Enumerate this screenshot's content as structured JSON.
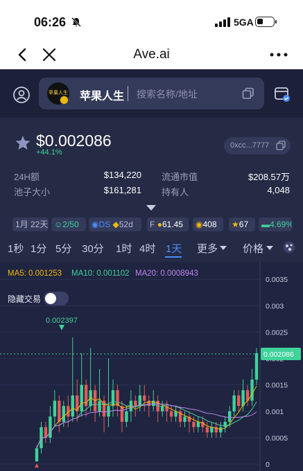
{
  "status_bar": {
    "time": "06:26",
    "network": "5GA"
  },
  "browser": {
    "title": "Ave.ai"
  },
  "search": {
    "token_name": "苹果人生",
    "token_logo_text": "苹果人生",
    "placeholder": "搜索名称/地址"
  },
  "token": {
    "price": "$0.002086",
    "change": "+44.1%",
    "address": "0xcc...7777"
  },
  "stats": {
    "vol_label": "24H额",
    "vol_value": "$134,220",
    "mcap_label": "流通市值",
    "mcap_value": "$208.57万",
    "pool_label": "池子大小",
    "pool_value": "$161,281",
    "holders_label": "持有人",
    "holders_value": "4,048"
  },
  "tags": {
    "age": "1月 22天",
    "ratio": "2/50",
    "ds": "DS",
    "days": "52d",
    "score": "61.45",
    "bag": "408",
    "cup": "67",
    "cash": "4.69%"
  },
  "timeframes": [
    "1秒",
    "1分",
    "5分",
    "30分",
    "1时",
    "4时",
    "1天",
    "更多",
    "价格"
  ],
  "colors": {
    "up": "#3fd29a",
    "down": "#e05b5b",
    "accent": "#4a8dff",
    "bg": "#252a45"
  },
  "chart_data": {
    "type": "candlestick",
    "legend": [
      {
        "name": "MA5",
        "value": "0.001253",
        "color": "#f0b90b"
      },
      {
        "name": "MA10",
        "value": "0.001102",
        "color": "#3fd29a"
      },
      {
        "name": "MA20",
        "value": "0.0008943",
        "color": "#c084f0"
      }
    ],
    "hide_trades_label": "隐藏交易",
    "peak_label": "0.002397",
    "current_price": "0.002086",
    "y_ticks": [
      "0.0035",
      "0.003",
      "0.0025",
      "0.002",
      "0.0015",
      "0.001",
      "0.0005",
      "0"
    ],
    "ylim": [
      0,
      0.0037
    ],
    "candles": [
      [
        5e-05,
        0.0003,
        5e-05,
        0.00035,
        "u"
      ],
      [
        0.0003,
        0.0007,
        0.0002,
        0.0008,
        "u"
      ],
      [
        0.0007,
        0.0005,
        0.0004,
        0.0008,
        "d"
      ],
      [
        0.0005,
        0.0009,
        0.0004,
        0.0011,
        "u"
      ],
      [
        0.0009,
        0.0012,
        0.0007,
        0.0014,
        "u"
      ],
      [
        0.0012,
        0.0008,
        0.0006,
        0.0013,
        "d"
      ],
      [
        0.0008,
        0.0011,
        0.0007,
        0.0012,
        "u"
      ],
      [
        0.0011,
        0.0009,
        0.0007,
        0.0013,
        "d"
      ],
      [
        0.0009,
        0.0013,
        0.0008,
        0.0024,
        "u"
      ],
      [
        0.0013,
        0.001,
        0.0008,
        0.0016,
        "d"
      ],
      [
        0.001,
        0.0015,
        0.0009,
        0.0021,
        "u"
      ],
      [
        0.0015,
        0.0011,
        0.0009,
        0.0016,
        "d"
      ],
      [
        0.0011,
        0.0014,
        0.001,
        0.0022,
        "u"
      ],
      [
        0.0014,
        0.001,
        0.0008,
        0.0015,
        "d"
      ],
      [
        0.001,
        0.0012,
        0.0009,
        0.0018,
        "u"
      ],
      [
        0.0012,
        0.0009,
        0.0006,
        0.0013,
        "d"
      ],
      [
        0.0009,
        0.0011,
        0.0007,
        0.002,
        "u"
      ],
      [
        0.0011,
        0.0014,
        0.0009,
        0.0016,
        "u"
      ],
      [
        0.0014,
        0.0011,
        0.0009,
        0.0015,
        "d"
      ],
      [
        0.0011,
        0.0008,
        0.0006,
        0.0012,
        "d"
      ],
      [
        0.0008,
        0.001,
        0.0007,
        0.0011,
        "u"
      ],
      [
        0.001,
        0.0012,
        0.0008,
        0.0014,
        "u"
      ],
      [
        0.0012,
        0.0011,
        0.0009,
        0.0013,
        "d"
      ],
      [
        0.0011,
        0.0013,
        0.001,
        0.0015,
        "u"
      ],
      [
        0.0013,
        0.0012,
        0.001,
        0.0015,
        "d"
      ],
      [
        0.0012,
        0.0011,
        0.0009,
        0.0013,
        "d"
      ],
      [
        0.0011,
        0.0012,
        0.001,
        0.0014,
        "u"
      ],
      [
        0.0012,
        0.001,
        0.0008,
        0.0013,
        "d"
      ],
      [
        0.001,
        0.0011,
        0.0009,
        0.0012,
        "u"
      ],
      [
        0.0011,
        0.001,
        0.0008,
        0.0012,
        "d"
      ],
      [
        0.001,
        0.0009,
        0.0008,
        0.0011,
        "d"
      ],
      [
        0.0009,
        0.001,
        0.0008,
        0.0011,
        "u"
      ],
      [
        0.001,
        0.0008,
        0.0007,
        0.0011,
        "d"
      ],
      [
        0.0008,
        0.0009,
        0.0007,
        0.001,
        "u"
      ],
      [
        0.0009,
        0.0008,
        0.0006,
        0.001,
        "d"
      ],
      [
        0.0008,
        0.0007,
        0.0006,
        0.0009,
        "d"
      ],
      [
        0.0007,
        0.0008,
        0.0006,
        0.0009,
        "u"
      ],
      [
        0.0008,
        0.0007,
        0.0006,
        0.0009,
        "d"
      ],
      [
        0.0007,
        0.0006,
        0.0005,
        0.0008,
        "d"
      ],
      [
        0.0006,
        0.0007,
        0.0005,
        0.0008,
        "u"
      ],
      [
        0.0007,
        0.0006,
        0.0005,
        0.0008,
        "d"
      ],
      [
        0.0006,
        0.0007,
        0.0005,
        0.0008,
        "u"
      ],
      [
        0.0007,
        0.0008,
        0.0006,
        0.0009,
        "u"
      ],
      [
        0.0008,
        0.001,
        0.0007,
        0.0011,
        "u"
      ],
      [
        0.001,
        0.0013,
        0.0009,
        0.0014,
        "u"
      ],
      [
        0.0013,
        0.0011,
        0.001,
        0.0014,
        "d"
      ],
      [
        0.0011,
        0.0014,
        0.001,
        0.0016,
        "u"
      ],
      [
        0.0014,
        0.0012,
        0.0011,
        0.0015,
        "d"
      ],
      [
        0.0012,
        0.0016,
        0.0011,
        0.0018,
        "u"
      ],
      [
        0.0016,
        0.0021,
        0.0015,
        0.0022,
        "u"
      ]
    ]
  }
}
